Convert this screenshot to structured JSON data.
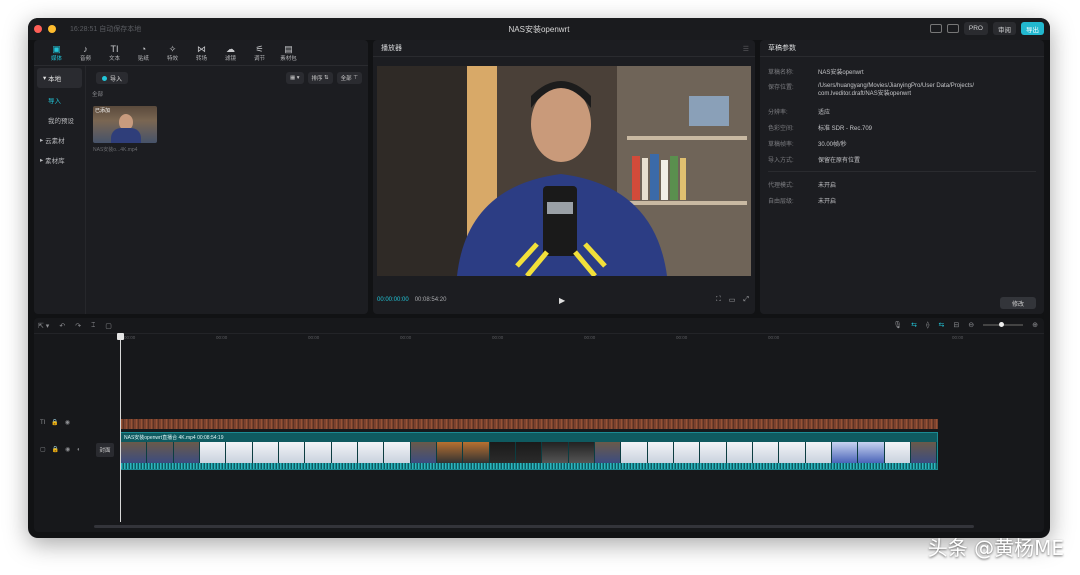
{
  "window": {
    "title": "NAS安装openwrt",
    "autosave": "16:28:51 自动保存本地",
    "buttons": {
      "pro": "PRO",
      "review": "审阅",
      "export": "导出"
    }
  },
  "media_panel": {
    "tools": [
      {
        "label": "媒体",
        "icon": "▣"
      },
      {
        "label": "音频",
        "icon": "♪"
      },
      {
        "label": "文本",
        "icon": "TI"
      },
      {
        "label": "贴纸",
        "icon": "◔"
      },
      {
        "label": "特效",
        "icon": "✧"
      },
      {
        "label": "转场",
        "icon": "⋈"
      },
      {
        "label": "滤镜",
        "icon": "☁"
      },
      {
        "label": "调节",
        "icon": "⚟"
      },
      {
        "label": "素材包",
        "icon": "▤"
      }
    ],
    "sidebar": {
      "local": "本地",
      "import": "导入",
      "my_presets": "我的预设",
      "cloud": "云素材",
      "library": "素材库"
    },
    "import_button": "导入",
    "sort": "排序",
    "filter": "全部",
    "all_label": "全部",
    "thumb_tag": "已添加",
    "thumb_name": "NAS安装o...4K.mp4"
  },
  "player": {
    "title": "播放器",
    "current_time": "00:00:00:00",
    "total_time": "00:08:54:20"
  },
  "properties": {
    "title": "草稿参数",
    "rows": [
      {
        "key": "草稿名称:",
        "value": "NAS安装openwrt"
      },
      {
        "key": "保存位置:",
        "value": "/Users/huangyang/Movies/JianyingPro/User Data/Projects/ com.lveditor.draft/NAS安装openwrt"
      },
      {
        "key": "分辨率:",
        "value": "适应"
      },
      {
        "key": "色彩空间:",
        "value": "标准 SDR - Rec.709"
      },
      {
        "key": "草稿帧率:",
        "value": "30.00帧/秒"
      },
      {
        "key": "导入方式:",
        "value": "保留在原有位置"
      }
    ],
    "rows2": [
      {
        "key": "代理模式:",
        "value": "未开启"
      },
      {
        "key": "自由层级:",
        "value": "未开启"
      }
    ],
    "modify": "修改"
  },
  "timeline": {
    "ticks": [
      "00:00",
      "00:00",
      "00:00",
      "00:00",
      "00:00",
      "00:00",
      "00:00",
      "00:00",
      "00:00"
    ],
    "cover": "封面",
    "clip_label": "NAS安装openwrt直播合 4K.mp4   00:08:54:19"
  },
  "watermark": "头条 @黄杨ME",
  "colors": {
    "accent": "#22c5d8",
    "background": "#111214"
  }
}
